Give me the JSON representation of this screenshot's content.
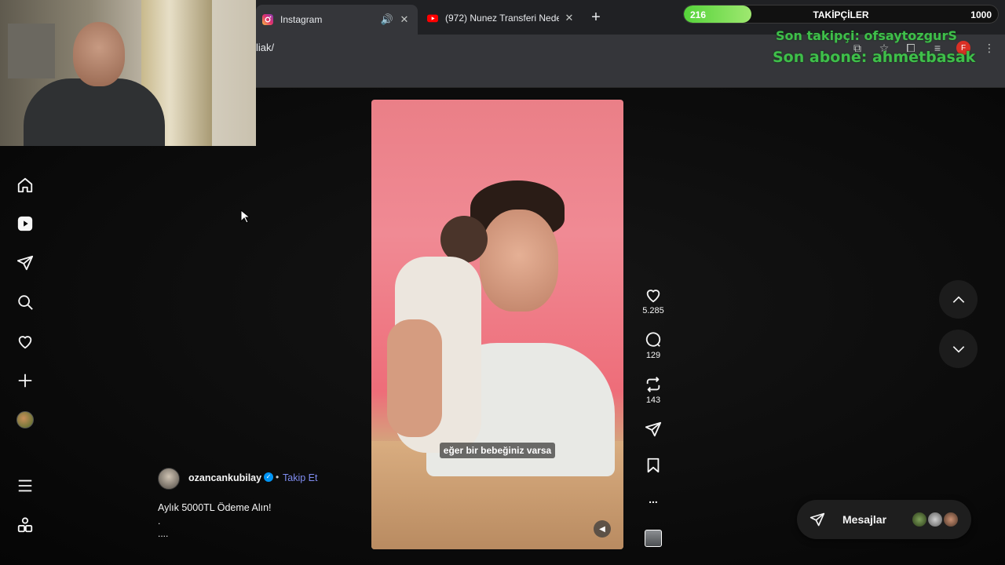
{
  "browser": {
    "tabs": [
      {
        "title": "Instagram",
        "active": true
      },
      {
        "title": "(972) Nunez Transferi Neden",
        "active": false
      }
    ],
    "url": "liak/"
  },
  "stream_overlay": {
    "followers_current": "216",
    "followers_label": "TAKİPÇİLER",
    "followers_goal": "1000",
    "follower_progress": 0.216,
    "last_follower": "Son takipçi: ofsaytozgurS",
    "last_subscriber": "Son abone: ahmetbasak"
  },
  "profile_initial": "F",
  "reel": {
    "caption_overlay": "eğer bir bebeğiniz varsa",
    "likes": "5.285",
    "comments": "129",
    "reposts": "143",
    "more": "..."
  },
  "author": {
    "username": "ozancankubilay",
    "follow": "Takip Et",
    "separator": "•",
    "description": "Aylık 5000TL Ödeme Alın!",
    "desc_line2": ".",
    "desc_line3": "...."
  },
  "messages": {
    "label": "Mesajlar"
  },
  "colors": {
    "accent_link": "#7f8cf0",
    "verified": "#0095f6",
    "overlay_green": "#3fbf4a"
  }
}
